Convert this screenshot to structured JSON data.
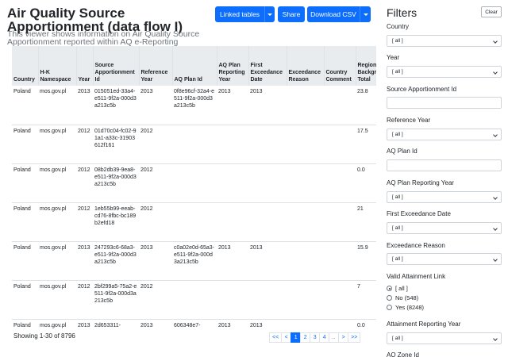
{
  "header": {
    "title": "Air Quality Source Apportionment (data flow I)",
    "subtitle": "This viewer shows information on Air Quality Source Apportionment reported within AQ e-Reporting",
    "buttons": {
      "linked_tables": "Linked tables",
      "share": "Share",
      "download_csv": "Download CSV"
    }
  },
  "table": {
    "columns": [
      "Country",
      "H-K Namespace",
      "Year",
      "Source Apportionment Id",
      "Reference Year",
      "AQ Plan Id",
      "AQ Plan Reporting Year",
      "First Exceedance Date",
      "Exceedance Reason",
      "Country Comment",
      "Regional Background Total"
    ],
    "rows": [
      [
        "Poland",
        "mos.gov.pl",
        "2013",
        "015051ed-33a4-e511-9f2a-000d3a213c5b",
        "2013",
        "0f8e96cf-32a4-e511-9f2a-000d3a213c5b",
        "2013",
        "2013",
        "",
        "",
        "23.8"
      ],
      [
        "Poland",
        "mos.gov.pl",
        "2012",
        "01d70c04-fc02-91a1-a33c-31903612f161",
        "2012",
        "",
        "",
        "",
        "",
        "",
        "17.5"
      ],
      [
        "Poland",
        "mos.gov.pl",
        "2012",
        "08b2db39-9ea8-e511-9f2a-000d3a213c5b",
        "2012",
        "",
        "",
        "",
        "",
        "",
        "0.0"
      ],
      [
        "Poland",
        "mos.gov.pl",
        "2012",
        "1eb55b99-eeab-cd76-8fbc-bc189b2efd18",
        "2012",
        "",
        "",
        "",
        "",
        "",
        "21"
      ],
      [
        "Poland",
        "mos.gov.pl",
        "2013",
        "247293c6-68a3-e511-9f2a-000d3a213c5b",
        "2013",
        "c0a02e0d-65a3-e511-9f2a-000d3a213c5b",
        "2013",
        "2013",
        "",
        "",
        "15.9"
      ],
      [
        "Poland",
        "mos.gov.pl",
        "2012",
        "2bf299a5-75a2-e511-9f2a-000d3a213c5b",
        "2012",
        "",
        "",
        "",
        "",
        "",
        "7"
      ],
      [
        "Poland",
        "mos.gov.pl",
        "2013",
        "2d653311-",
        "2013",
        "606348e7-",
        "2013",
        "2013",
        "",
        "",
        "0.0"
      ]
    ]
  },
  "footer": {
    "showing": "Showing 1-30 of 8796",
    "pager": [
      "<<",
      "<",
      "1",
      "2",
      "3",
      "4",
      "..",
      ">",
      ">>"
    ],
    "active_page": "1"
  },
  "sidebar": {
    "title": "Filters",
    "clear": "Clear",
    "filters": [
      {
        "label": "Country",
        "type": "select",
        "value": "[ all ]"
      },
      {
        "label": "Year",
        "type": "select",
        "value": "[ all ]"
      },
      {
        "label": "Source Apportionment Id",
        "type": "input",
        "value": ""
      },
      {
        "label": "Reference Year",
        "type": "select",
        "value": "[ all ]"
      },
      {
        "label": "AQ Plan Id",
        "type": "input",
        "value": ""
      },
      {
        "label": "AQ Plan Reporting Year",
        "type": "select",
        "value": "[ all ]"
      },
      {
        "label": "First Exceedance Date",
        "type": "select",
        "value": "[ all ]"
      },
      {
        "label": "Exceedance Reason",
        "type": "select",
        "value": "[ all ]"
      },
      {
        "label": "Valid Attainment Link",
        "type": "radio",
        "options": [
          "[ all ]",
          "No (548)",
          "Yes (8248)"
        ],
        "selected": "[ all ]"
      },
      {
        "label": "Attainment Reporting Year",
        "type": "select",
        "value": "[ all ]"
      },
      {
        "label": "AQ Zone Id",
        "type": "label"
      }
    ]
  }
}
